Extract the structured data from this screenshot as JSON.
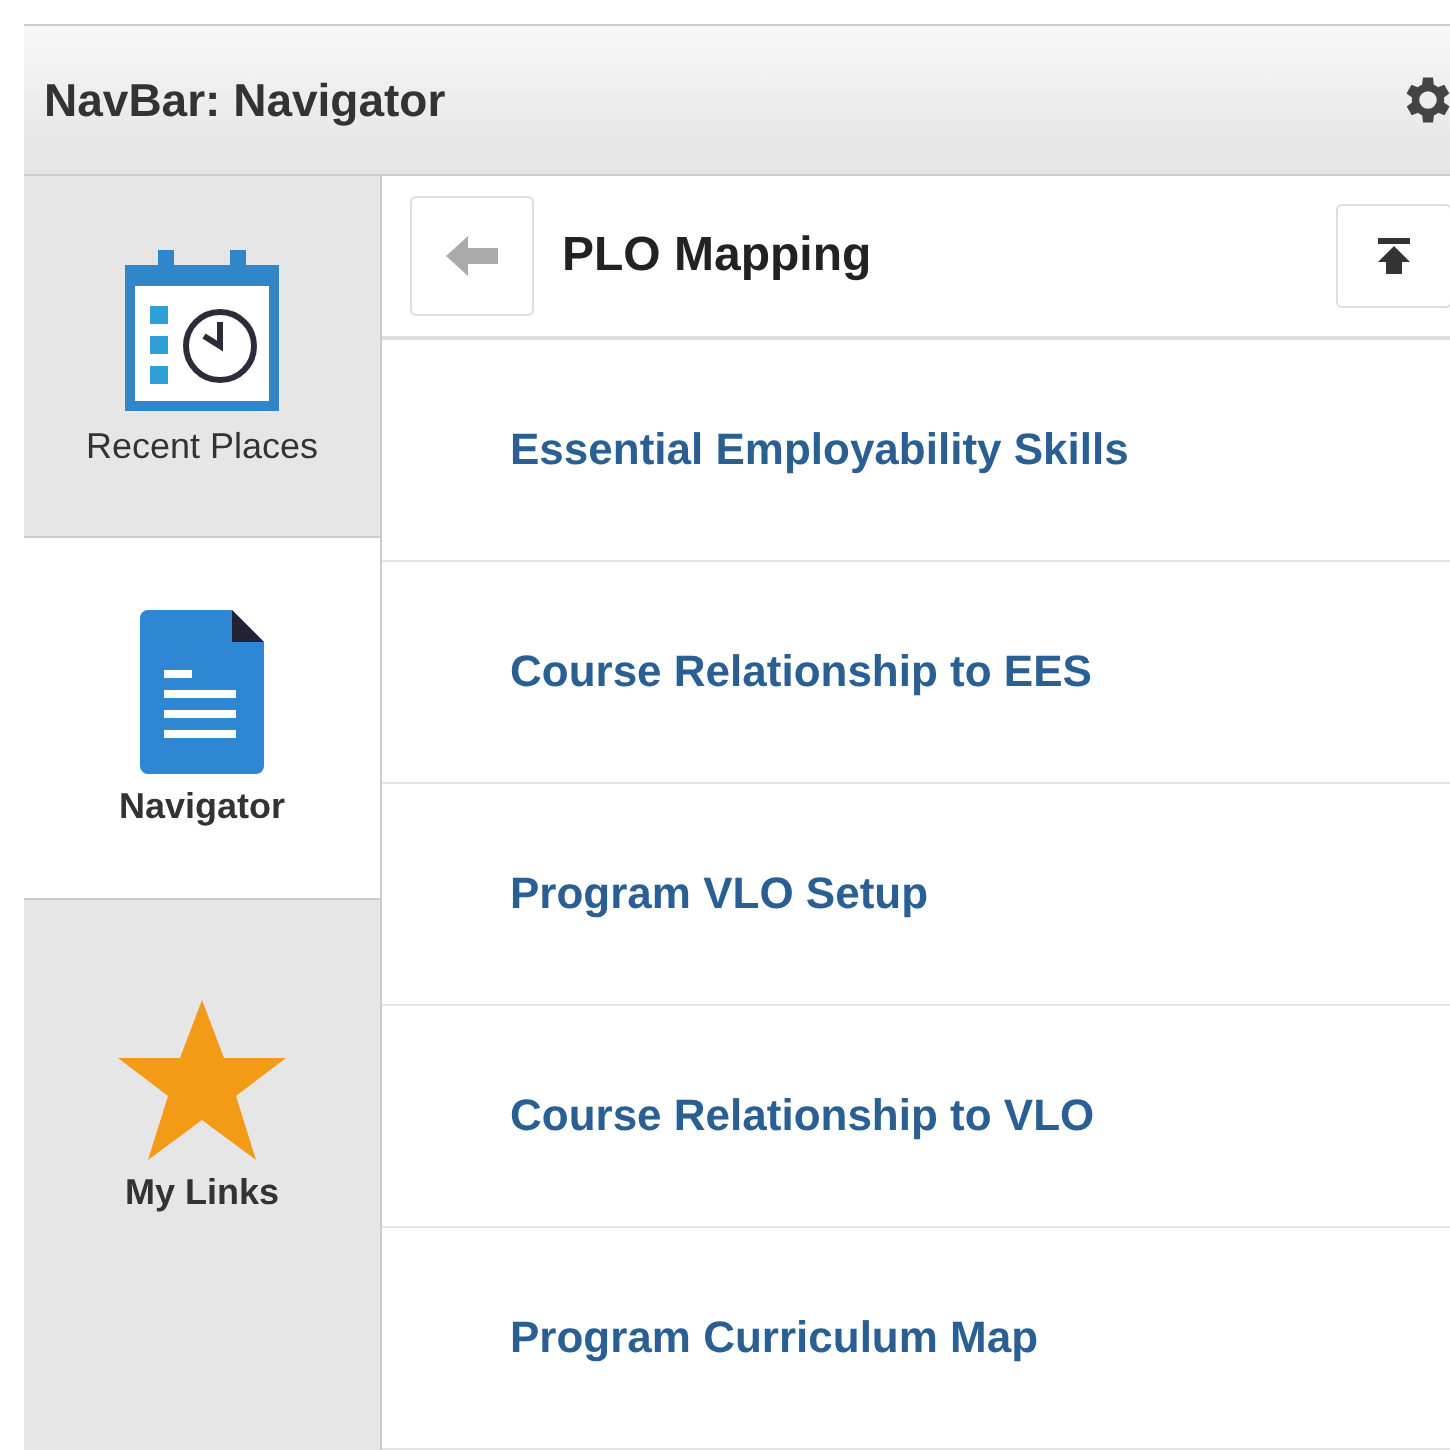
{
  "header": {
    "title": "NavBar: Navigator"
  },
  "sidebar": {
    "items": [
      {
        "label": "Recent Places",
        "kind": "recent",
        "selected": false
      },
      {
        "label": "Navigator",
        "kind": "navigator",
        "selected": true
      },
      {
        "label": "My Links",
        "kind": "links",
        "selected": false
      }
    ]
  },
  "panel": {
    "title": "PLO Mapping",
    "items": [
      {
        "label": "Essential Employability Skills"
      },
      {
        "label": "Course Relationship to EES"
      },
      {
        "label": "Program VLO Setup"
      },
      {
        "label": "Course Relationship to VLO"
      },
      {
        "label": "Program Curriculum Map"
      }
    ]
  }
}
